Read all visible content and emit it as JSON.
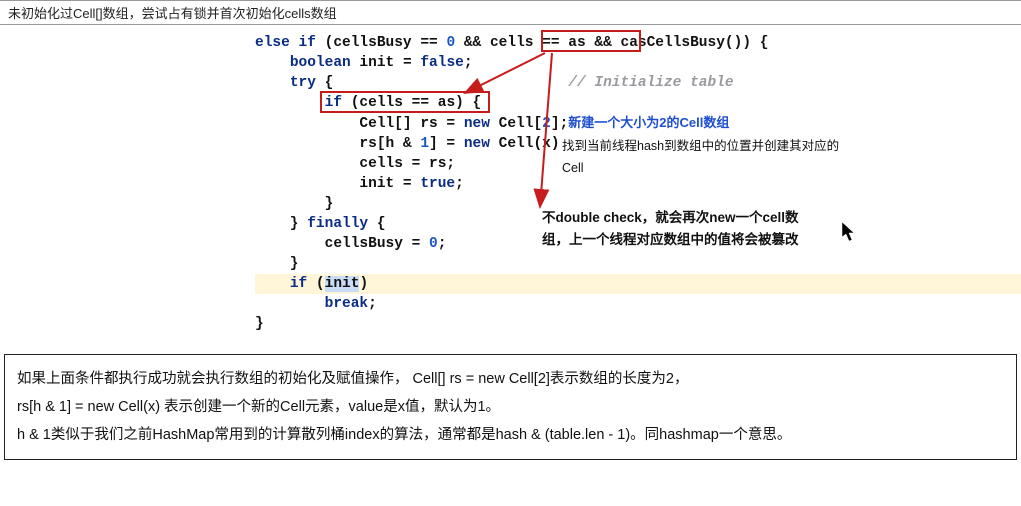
{
  "header": {
    "title": "未初始化过Cell[]数组，尝试占有锁并首次初始化cells数组"
  },
  "code": {
    "c01_a": "else if",
    "c01_b": " (cellsBusy == ",
    "c01_c": "0",
    "c01_d": " && ",
    "c01_e": "cells == as",
    "c01_f": " && casCellsBusy()) {",
    "c02_a": "    ",
    "c02_b": "boolean",
    "c02_c": " init = ",
    "c02_d": "false",
    "c02_e": ";",
    "c03_a": "    ",
    "c03_b": "try",
    "c03_c": " {                           ",
    "c03_d": "// Initialize table",
    "c04_a": "        ",
    "c04_b": "if",
    "c04_c": " (cells == as) {",
    "c05_a": "            Cell[] rs = ",
    "c05_b": "new",
    "c05_c": " Cell[",
    "c05_d": "2",
    "c05_e": "];",
    "c06_a": "            rs[h & ",
    "c06_b": "1",
    "c06_c": "] = ",
    "c06_d": "new",
    "c06_e": " Cell(x)",
    "c07_a": "            cells = rs;",
    "c08_a": "            init = ",
    "c08_b": "true",
    "c08_c": ";",
    "c09_a": "        }",
    "c10_a": "    } ",
    "c10_b": "finally",
    "c10_c": " {",
    "c11_a": "        cellsBusy = ",
    "c11_b": "0",
    "c11_c": ";",
    "c12_a": "    }",
    "c13_a": "    ",
    "c13_b": "if",
    "c13_c": " (",
    "c13_d": "init",
    "c13_e": ")",
    "c14_a": "        ",
    "c14_b": "break",
    "c14_c": ";",
    "c15_a": "}"
  },
  "annot": {
    "blue": "新建一个大小为2的Cell数组",
    "side1": "找到当前线程hash到数组中的位置并创建其对应的",
    "side2": "Cell",
    "strong1": "不double check，就会再次new一个cell数",
    "strong2": "组，上一个线程对应数组中的值将会被篡改"
  },
  "bottom": {
    "p1": "如果上面条件都执行成功就会执行数组的初始化及赋值操作， Cell[] rs = new Cell[2]表示数组的长度为2，",
    "p2": "rs[h & 1] = new Cell(x) 表示创建一个新的Cell元素，value是x值，默认为1。",
    "p3": "h & 1类似于我们之前HashMap常用到的计算散列桶index的算法，通常都是hash & (table.len - 1)。同hashmap一个意思。"
  }
}
